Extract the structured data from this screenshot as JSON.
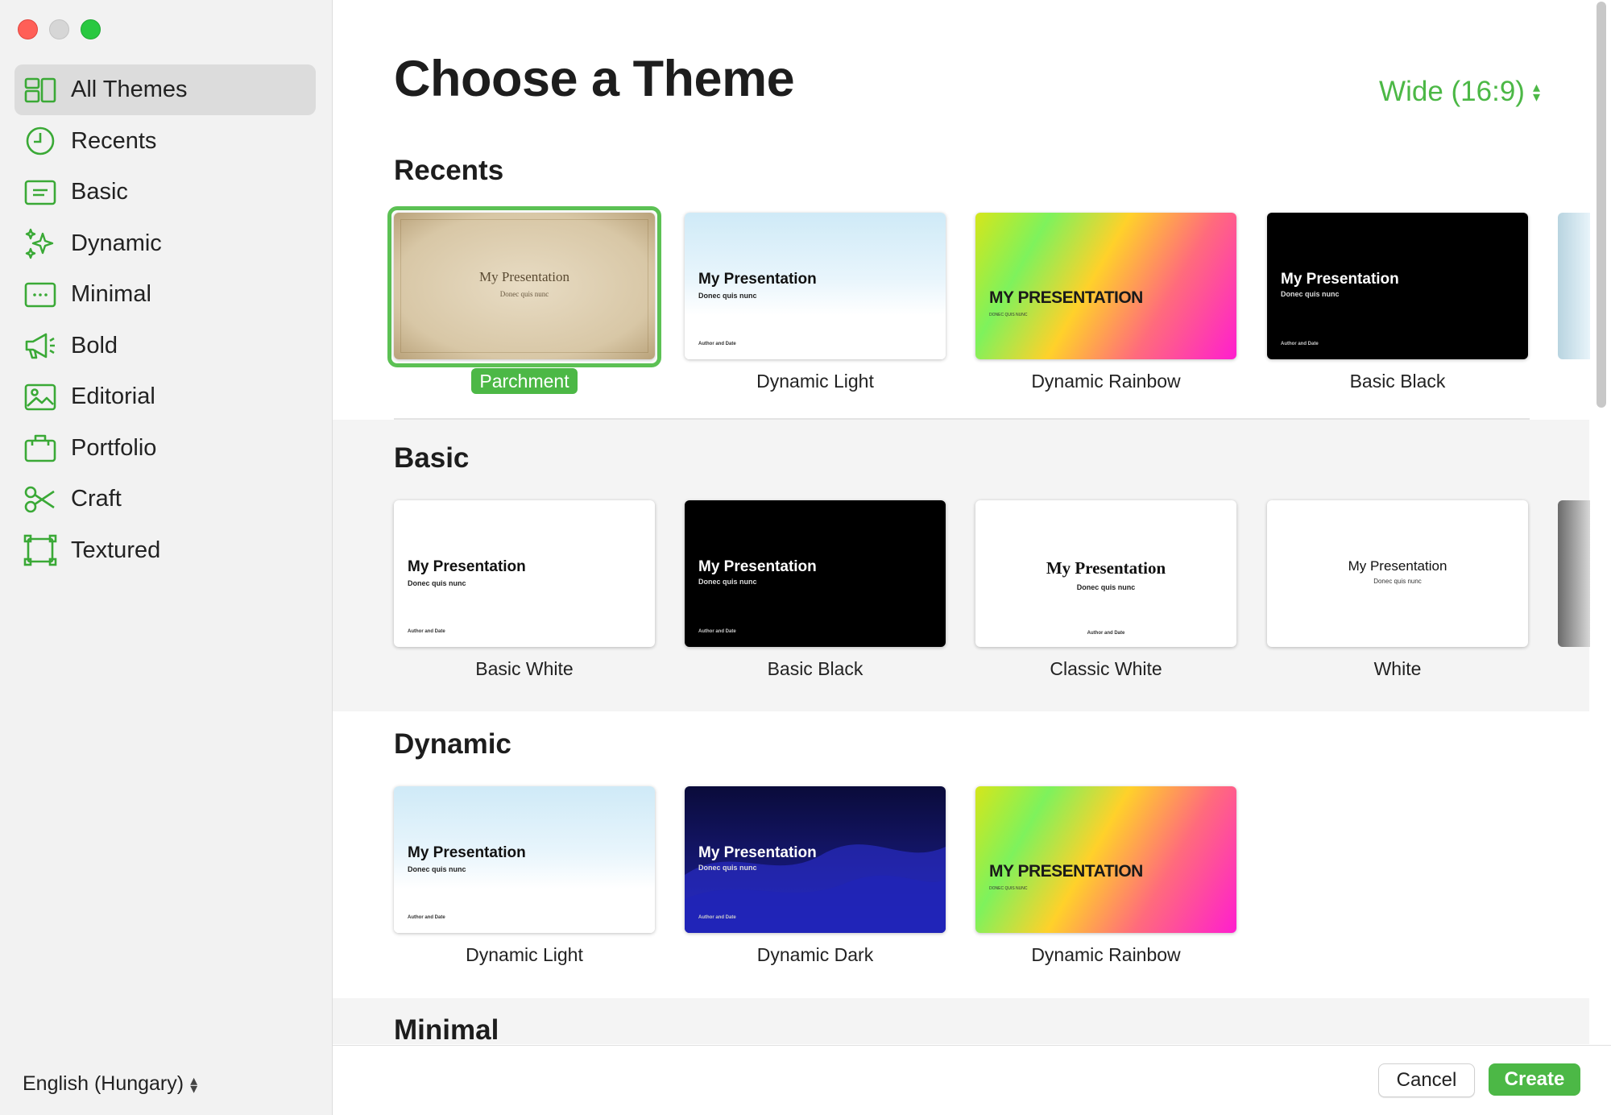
{
  "sidebar": {
    "items": [
      {
        "label": "All Themes",
        "icon": "all-themes-icon"
      },
      {
        "label": "Recents",
        "icon": "clock-icon"
      },
      {
        "label": "Basic",
        "icon": "basic-icon"
      },
      {
        "label": "Dynamic",
        "icon": "sparkles-icon"
      },
      {
        "label": "Minimal",
        "icon": "minimal-icon"
      },
      {
        "label": "Bold",
        "icon": "megaphone-icon"
      },
      {
        "label": "Editorial",
        "icon": "photo-icon"
      },
      {
        "label": "Portfolio",
        "icon": "briefcase-icon"
      },
      {
        "label": "Craft",
        "icon": "scissors-icon"
      },
      {
        "label": "Textured",
        "icon": "textured-frame-icon"
      }
    ],
    "language": "English (Hungary)"
  },
  "header": {
    "title": "Choose a Theme",
    "aspect": "Wide (16:9)"
  },
  "sections": {
    "recents": {
      "title": "Recents",
      "themes": [
        {
          "name": "Parchment",
          "thumb_title": "My Presentation",
          "thumb_sub": "Donec quis nunc"
        },
        {
          "name": "Dynamic Light",
          "thumb_title": "My Presentation",
          "thumb_sub": "Donec quis nunc",
          "thumb_author": "Author and Date"
        },
        {
          "name": "Dynamic Rainbow",
          "thumb_title": "MY PRESENTATION",
          "thumb_sub": "DONEC QUIS NUNC"
        },
        {
          "name": "Basic Black",
          "thumb_title": "My Presentation",
          "thumb_sub": "Donec quis nunc",
          "thumb_author": "Author and Date"
        }
      ]
    },
    "basic": {
      "title": "Basic",
      "themes": [
        {
          "name": "Basic White",
          "thumb_title": "My Presentation",
          "thumb_sub": "Donec quis nunc",
          "thumb_author": "Author and Date"
        },
        {
          "name": "Basic Black",
          "thumb_title": "My Presentation",
          "thumb_sub": "Donec quis nunc",
          "thumb_author": "Author and Date"
        },
        {
          "name": "Classic White",
          "thumb_title": "My Presentation",
          "thumb_sub": "Donec quis nunc",
          "thumb_author": "Author and Date"
        },
        {
          "name": "White",
          "thumb_title": "My Presentation",
          "thumb_sub": "Donec quis nunc"
        }
      ]
    },
    "dynamic": {
      "title": "Dynamic",
      "themes": [
        {
          "name": "Dynamic Light",
          "thumb_title": "My Presentation",
          "thumb_sub": "Donec quis nunc",
          "thumb_author": "Author and Date"
        },
        {
          "name": "Dynamic Dark",
          "thumb_title": "My Presentation",
          "thumb_sub": "Donec quis nunc",
          "thumb_author": "Author and Date"
        },
        {
          "name": "Dynamic Rainbow",
          "thumb_title": "MY PRESENTATION",
          "thumb_sub": "DONEC QUIS NUNC"
        }
      ]
    },
    "minimal": {
      "title": "Minimal"
    }
  },
  "footer": {
    "cancel": "Cancel",
    "create": "Create"
  },
  "colors": {
    "accent": "#4cb846",
    "sidebar_bg": "#f2f2f2",
    "selected_item_bg": "#dcdcdc"
  }
}
